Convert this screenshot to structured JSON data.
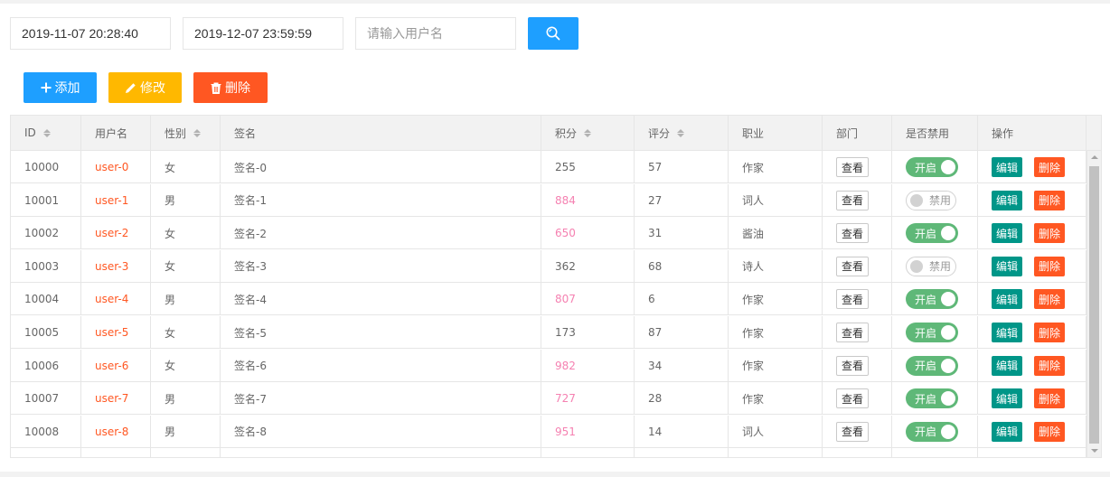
{
  "filters": {
    "start_date": "2019-11-07 20:28:40",
    "end_date": "2019-12-07 23:59:59",
    "username_placeholder": "请输入用户名",
    "search_icon": "search-icon",
    "search_color": "#1e9fff"
  },
  "toolbar": {
    "add_label": "添加",
    "edit_label": "修改",
    "delete_label": "删除",
    "add_icon": "plus-icon",
    "edit_icon": "pencil-icon",
    "delete_icon": "trash-icon",
    "add_color": "#1e9fff",
    "edit_color": "#ffb800",
    "delete_color": "#ff5722"
  },
  "table": {
    "columns": [
      "ID",
      "用户名",
      "性别",
      "签名",
      "积分",
      "评分",
      "职业",
      "部门",
      "是否禁用",
      "操作"
    ],
    "sortable": [
      true,
      false,
      true,
      false,
      true,
      true,
      false,
      false,
      false,
      false
    ],
    "view_label": "查看",
    "switch_on_label": "开启",
    "switch_off_label": "禁用",
    "edit_label": "编辑",
    "delete_label": "删除",
    "colors": {
      "username": "#ff5722",
      "score_highlight": "#f581b1",
      "switch_on": "#5fb878",
      "edit_button": "#009688",
      "delete_button": "#ff5722"
    },
    "rows": [
      {
        "id": "10000",
        "username": "user-0",
        "gender": "女",
        "sign": "签名-0",
        "score": "255",
        "score_highlight": false,
        "rating": "57",
        "job": "作家",
        "enabled": true
      },
      {
        "id": "10001",
        "username": "user-1",
        "gender": "男",
        "sign": "签名-1",
        "score": "884",
        "score_highlight": true,
        "rating": "27",
        "job": "词人",
        "enabled": false
      },
      {
        "id": "10002",
        "username": "user-2",
        "gender": "女",
        "sign": "签名-2",
        "score": "650",
        "score_highlight": true,
        "rating": "31",
        "job": "酱油",
        "enabled": true
      },
      {
        "id": "10003",
        "username": "user-3",
        "gender": "女",
        "sign": "签名-3",
        "score": "362",
        "score_highlight": false,
        "rating": "68",
        "job": "诗人",
        "enabled": false
      },
      {
        "id": "10004",
        "username": "user-4",
        "gender": "男",
        "sign": "签名-4",
        "score": "807",
        "score_highlight": true,
        "rating": "6",
        "job": "作家",
        "enabled": true
      },
      {
        "id": "10005",
        "username": "user-5",
        "gender": "女",
        "sign": "签名-5",
        "score": "173",
        "score_highlight": false,
        "rating": "87",
        "job": "作家",
        "enabled": true
      },
      {
        "id": "10006",
        "username": "user-6",
        "gender": "女",
        "sign": "签名-6",
        "score": "982",
        "score_highlight": true,
        "rating": "34",
        "job": "作家",
        "enabled": true
      },
      {
        "id": "10007",
        "username": "user-7",
        "gender": "男",
        "sign": "签名-7",
        "score": "727",
        "score_highlight": true,
        "rating": "28",
        "job": "作家",
        "enabled": true
      },
      {
        "id": "10008",
        "username": "user-8",
        "gender": "男",
        "sign": "签名-8",
        "score": "951",
        "score_highlight": true,
        "rating": "14",
        "job": "词人",
        "enabled": true
      }
    ]
  }
}
